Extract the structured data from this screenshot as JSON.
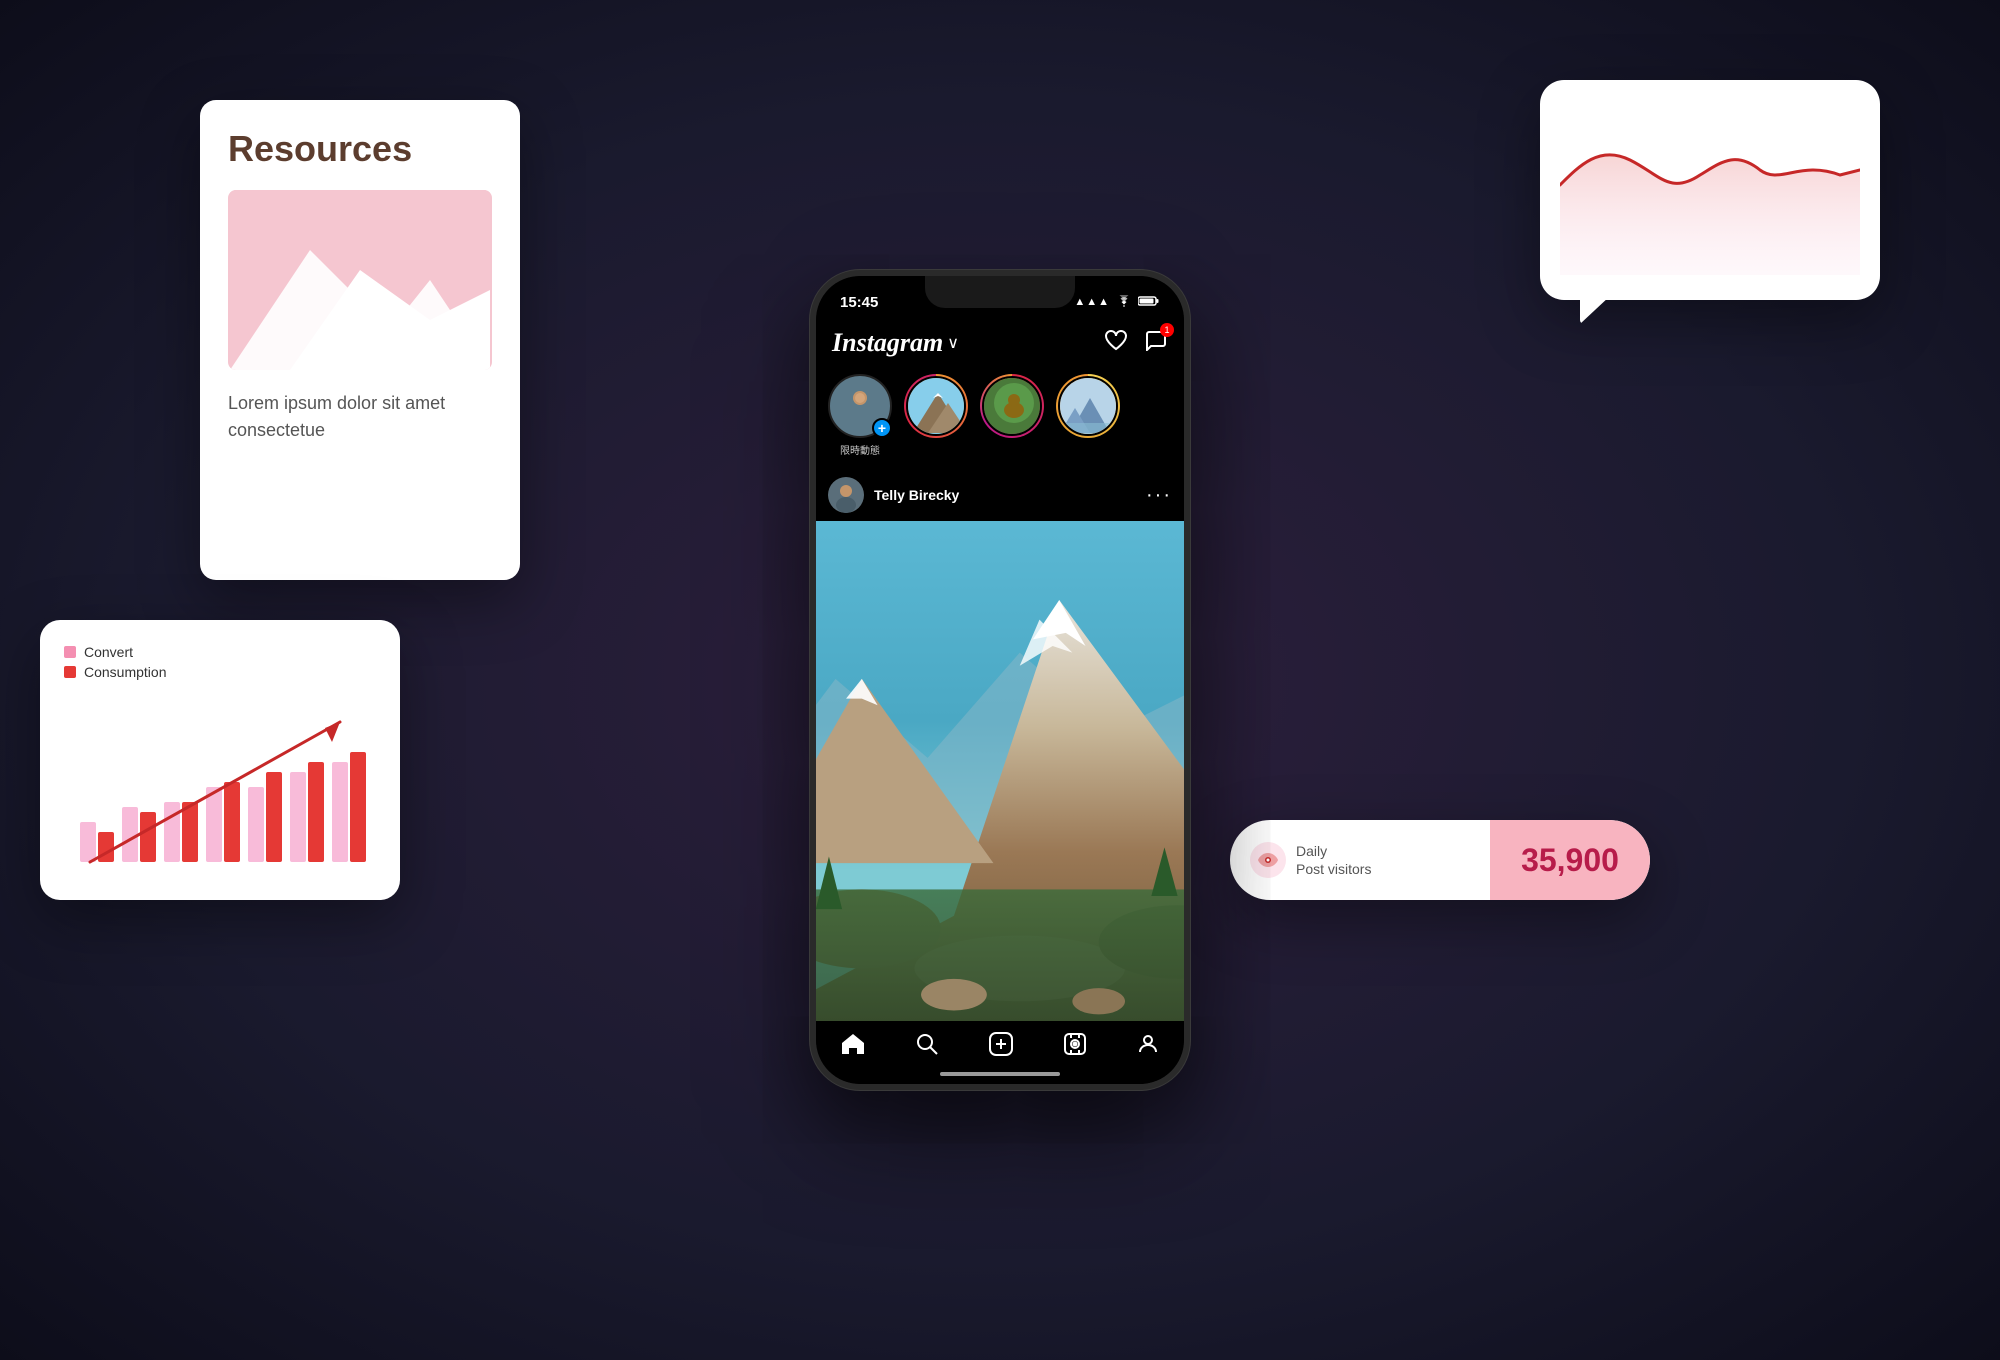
{
  "background": {
    "color": "#1a1a2e"
  },
  "resources_card": {
    "title": "Resources",
    "body_text": "Lorem ipsum dolor sit amet consectetue",
    "image_alt": "mountain illustration"
  },
  "chart_card": {
    "legend": [
      {
        "label": "Convert",
        "color": "#f48fb1"
      },
      {
        "label": "Consumption",
        "color": "#e53935"
      }
    ],
    "bars": [
      {
        "convert": 30,
        "consumption": 20
      },
      {
        "convert": 40,
        "consumption": 35
      },
      {
        "convert": 45,
        "consumption": 40
      },
      {
        "convert": 55,
        "consumption": 50
      },
      {
        "convert": 50,
        "consumption": 60
      },
      {
        "convert": 65,
        "consumption": 70
      },
      {
        "convert": 70,
        "consumption": 75
      }
    ]
  },
  "line_chart": {
    "alt": "line chart with red wave"
  },
  "visitors_card": {
    "label_line1": "Daily",
    "label_line2": "Post visitors",
    "number": "35,900"
  },
  "phone": {
    "status_bar": {
      "time": "15:45",
      "signal": "▲▲▲",
      "wifi": "WiFi",
      "battery": "🔋"
    },
    "header": {
      "logo": "Instagram",
      "chevron": "∨"
    },
    "stories": [
      {
        "label": "限時動態",
        "has_add": true,
        "ring": "none"
      },
      {
        "label": "",
        "ring": "gradient",
        "avatar": "mountain"
      },
      {
        "label": "",
        "ring": "gradient-red",
        "avatar": "forest"
      },
      {
        "label": "",
        "ring": "gold",
        "avatar": "lake"
      }
    ],
    "post": {
      "username": "Telly Birecky",
      "image_alt": "mountain landscape"
    },
    "nav_items": [
      "home",
      "search",
      "add",
      "reels",
      "profile"
    ]
  }
}
